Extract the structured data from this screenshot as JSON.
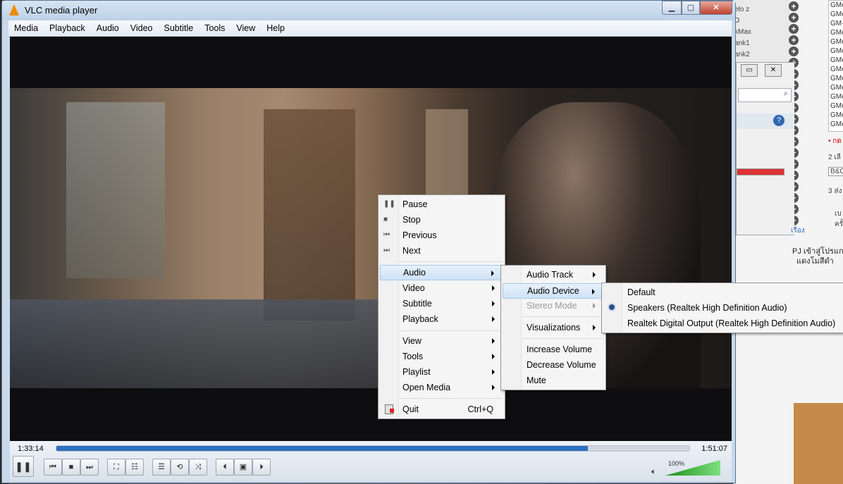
{
  "window": {
    "title": "VLC media player",
    "controls": {
      "minimize": "▁",
      "maximize": "▢",
      "close": "✕"
    }
  },
  "menubar": [
    "Media",
    "Playback",
    "Audio",
    "Video",
    "Subtitle",
    "Tools",
    "View",
    "Help"
  ],
  "player": {
    "elapsed": "1:33:14",
    "total": "1:51:07",
    "progress_fraction": 0.84,
    "volume": "100%",
    "volume_fraction": 1.0,
    "colors": {
      "seek_fill": "#2e6fbf",
      "volume_fill": "#1a8f1a"
    }
  },
  "context_menu": {
    "pause": "Pause",
    "stop": "Stop",
    "previous": "Previous",
    "next": "Next",
    "audio": "Audio",
    "video": "Video",
    "subtitle": "Subtitle",
    "playback": "Playback",
    "view": "View",
    "tools": "Tools",
    "playlist": "Playlist",
    "open_media": "Open Media",
    "quit": "Quit",
    "quit_shortcut": "Ctrl+Q"
  },
  "audio_menu": {
    "audio_track": "Audio Track",
    "audio_device": "Audio Device",
    "stereo_mode": "Stereo Mode",
    "visualizations": "Visualizations",
    "increase_volume": "Increase Volume",
    "decrease_volume": "Decrease Volume",
    "mute": "Mute"
  },
  "device_menu": {
    "default": "Default",
    "speakers": "Speakers (Realtek High Definition Audio)",
    "digital": "Realtek Digital Output (Realtek High Definition Audio)",
    "selected": "speakers"
  },
  "background": {
    "side_list": [
      "GMe",
      "GMe",
      "GM-",
      "GMe",
      "GMe",
      "GMe",
      "GMe",
      "GMe",
      "GMe",
      "GMe",
      "GMe",
      "GMe",
      "GMe",
      "GMe"
    ],
    "side_labels": [
      "elo z",
      "D",
      "kMax",
      "ank1",
      "ank2"
    ],
    "thai_line1": "PJ เข้าสู่โปรแกร",
    "thai_line2": "แดงโมสีดำ",
    "red_note": "• กด",
    "note2": "2 เลื",
    "note3": "3 ส่ง",
    "combo": "B&G",
    "link": "เรือง",
    "cut1": "เบ",
    "cut2": "ครั้"
  }
}
